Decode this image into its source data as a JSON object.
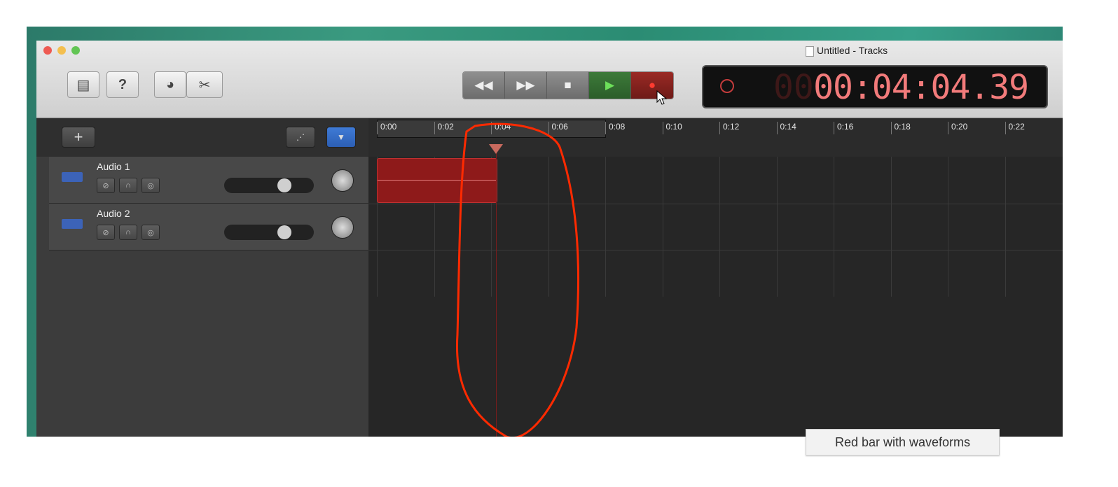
{
  "window": {
    "title": "Untitled - Tracks"
  },
  "toolbar": {
    "library_icon": "library-icon",
    "help_label": "?",
    "smart_controls_icon": "smart-controls-icon",
    "editors_icon": "scissors-icon"
  },
  "transport": {
    "rewind": "◀◀",
    "fast_forward": "▶▶",
    "stop": "■",
    "play": "▶",
    "record": "●"
  },
  "lcd": {
    "time": "00:04:04.39",
    "dim_digits": "00"
  },
  "tracks_header": {
    "add_label": "+"
  },
  "tracks": [
    {
      "name": "Audio 1",
      "volume": 0.7
    },
    {
      "name": "Audio 2",
      "volume": 0.7
    }
  ],
  "ruler": {
    "ticks": [
      "0:00",
      "0:02",
      "0:04",
      "0:06",
      "0:08",
      "0:10",
      "0:12",
      "0:14",
      "0:16",
      "0:18",
      "0:20",
      "0:22"
    ]
  },
  "region": {
    "track": "Audio 1",
    "color": "#8e1a1a"
  },
  "tooltip": {
    "text": "Red bar with waveforms"
  },
  "colors": {
    "annotation": "#ff2a00",
    "lcd": "#f27b7b",
    "record": "#c0392b"
  }
}
